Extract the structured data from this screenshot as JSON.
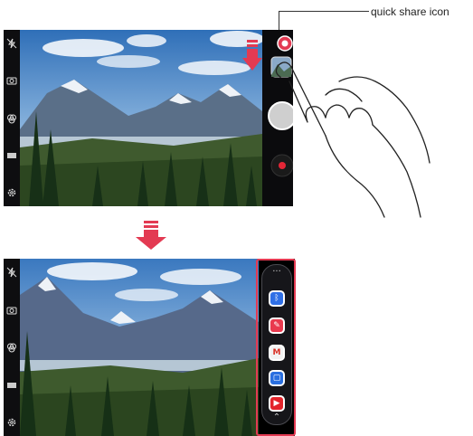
{
  "callout": {
    "label": "quick share icon"
  },
  "camera_top": {
    "rail_icons": [
      "flash-off-icon",
      "switch-camera-icon",
      "filter-icon",
      "mode-icon",
      "settings-icon"
    ]
  },
  "camera_bottom": {
    "rail_icons": [
      "flash-off-icon",
      "switch-camera-icon",
      "filter-icon",
      "mode-icon",
      "settings-icon"
    ],
    "share_bar": {
      "more_glyph": "···",
      "apps": [
        {
          "name": "bluetooth-icon",
          "glyph": "ᛒ",
          "color": "#2f6fe6"
        },
        {
          "name": "memo-icon",
          "glyph": "✎",
          "color": "#e9394e"
        },
        {
          "name": "gmail-icon",
          "glyph": "M",
          "color": "#e8e8e8"
        },
        {
          "name": "messaging-icon",
          "glyph": "▢",
          "color": "#2a6fe0"
        },
        {
          "name": "youtube-icon",
          "glyph": "▶",
          "color": "#e3242b"
        }
      ],
      "collapse_glyph": "⌃"
    }
  },
  "colors": {
    "accent": "#e33a52",
    "record": "#e32636",
    "arrow": "#e33a52"
  }
}
